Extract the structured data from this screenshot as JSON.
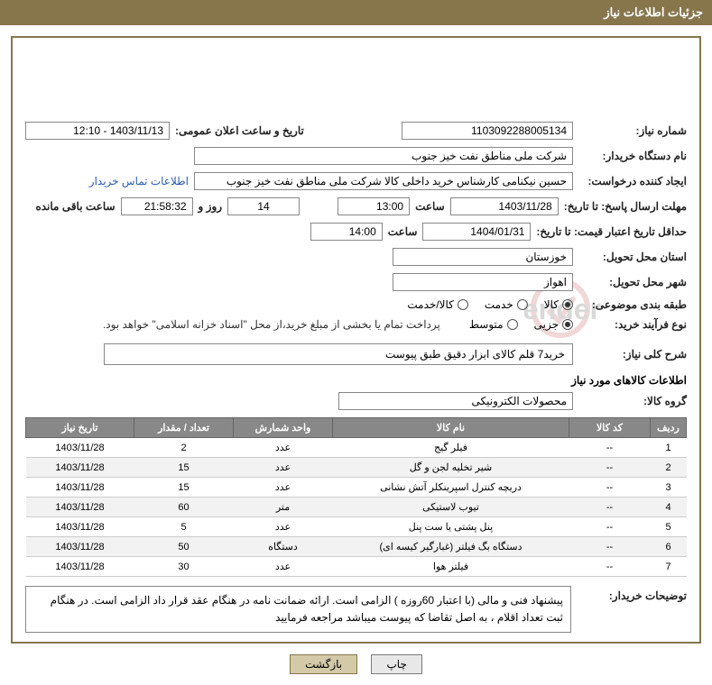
{
  "header_title": "جزئیات اطلاعات نیاز",
  "labels": {
    "need_no": "شماره نیاز:",
    "announce_date": "تاریخ و ساعت اعلان عمومی:",
    "buyer_org": "نام دستگاه خریدار:",
    "requester": "ایجاد کننده درخواست:",
    "contact_link": "اطلاعات تماس خریدار",
    "deadline": "مهلت ارسال پاسخ: تا تاریخ:",
    "time": "ساعت",
    "days_and": "روز و",
    "remaining": "ساعت باقی مانده",
    "valid_until": "حداقل تاریخ اعتبار قیمت: تا تاریخ:",
    "province": "استان محل تحویل:",
    "city": "شهر محل تحویل:",
    "classification": "طبقه بندی موضوعی:",
    "process_type": "نوع فرآیند خرید:",
    "main_desc": "شرح کلی نیاز:",
    "goods_info": "اطلاعات کالاهای مورد نیاز",
    "goods_group": "گروه کالا:",
    "buyer_notes": "توضیحات خریدار:"
  },
  "fields": {
    "need_no": "1103092288005134",
    "announce_date": "1403/11/13 - 12:10",
    "buyer_org": "شرکت ملی مناطق نفت خیز جنوب",
    "requester": "حسین  نیکنامی   کارشناس خرید داخلی کالا شرکت ملی مناطق نفت خیز جنوب",
    "deadline_date": "1403/11/28",
    "deadline_time": "13:00",
    "remaining_days": "14",
    "remaining_time": "21:58:32",
    "valid_date": "1404/01/31",
    "valid_time": "14:00",
    "province": "خوزستان",
    "city": "اهواز",
    "main_desc": "خرید7 قلم کالای ابزار دقیق طبق پیوست",
    "goods_group": "محصولات الکترونیکی",
    "notes": "پیشنهاد فنی و مالی (با اعتبار 60روزه ) الزامی است. ارائه ضمانت نامه در هنگام عقد قرار داد الزامی است. در هنگام ثبت تعداد اقلام ،  به اصل  تقاضا که پیوست میباشد مراجعه  فرمایید"
  },
  "classification_options": {
    "goods": "کالا",
    "service": "خدمت",
    "both": "کالا/خدمت"
  },
  "process_options": {
    "minor": "جزیی",
    "medium": "متوسط"
  },
  "process_note": "پرداخت تمام یا بخشی از مبلغ خرید،از محل \"اسناد خزانه اسلامی\" خواهد بود.",
  "table": {
    "headers": {
      "row": "ردیف",
      "code": "کد کالا",
      "name": "نام کالا",
      "unit": "واحد شمارش",
      "qty": "تعداد / مقدار",
      "date": "تاریخ نیاز"
    },
    "rows": [
      {
        "n": "1",
        "code": "--",
        "name": "فیلر گیج",
        "unit": "عدد",
        "qty": "2",
        "date": "1403/11/28"
      },
      {
        "n": "2",
        "code": "--",
        "name": "شیر تخلیه لجن و گل",
        "unit": "عدد",
        "qty": "15",
        "date": "1403/11/28"
      },
      {
        "n": "3",
        "code": "--",
        "name": "دریچه کنترل اسپرینکلر آتش نشانی",
        "unit": "عدد",
        "qty": "15",
        "date": "1403/11/28"
      },
      {
        "n": "4",
        "code": "--",
        "name": "تیوب لاستیکی",
        "unit": "متر",
        "qty": "60",
        "date": "1403/11/28"
      },
      {
        "n": "5",
        "code": "--",
        "name": "پنل پشتی یا ست پنل",
        "unit": "عدد",
        "qty": "5",
        "date": "1403/11/28"
      },
      {
        "n": "6",
        "code": "--",
        "name": "دستگاه بگ فیلتر (غبارگیر کیسه ای)",
        "unit": "دستگاه",
        "qty": "50",
        "date": "1403/11/28"
      },
      {
        "n": "7",
        "code": "--",
        "name": "فیلتر هوا",
        "unit": "عدد",
        "qty": "30",
        "date": "1403/11/28"
      }
    ]
  },
  "buttons": {
    "print": "چاپ",
    "back": "بازگشت"
  },
  "watermark": "AriaTender.net"
}
